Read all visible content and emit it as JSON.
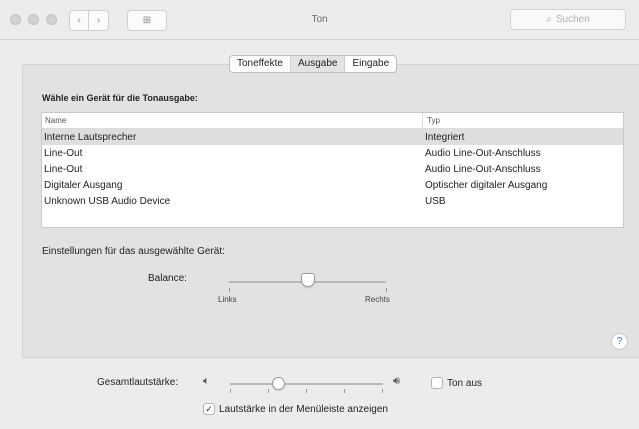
{
  "window": {
    "title": "Ton",
    "search_placeholder": "Suchen",
    "grid_icon": "⊞"
  },
  "tabs": [
    {
      "label": "Toneffekte",
      "active": false
    },
    {
      "label": "Ausgabe",
      "active": true
    },
    {
      "label": "Eingabe",
      "active": false
    }
  ],
  "output": {
    "heading": "Wähle ein Gerät für die Tonausgabe:",
    "columns": [
      "Name",
      "Typ"
    ],
    "devices": [
      {
        "name": "Interne Lautsprecher",
        "type": "Integriert",
        "selected": true
      },
      {
        "name": "Line-Out",
        "type": "Audio Line-Out-Anschluss",
        "selected": false
      },
      {
        "name": "Line-Out",
        "type": "Audio Line-Out-Anschluss",
        "selected": false
      },
      {
        "name": "Digitaler Ausgang",
        "type": "Optischer digitaler Ausgang",
        "selected": false
      },
      {
        "name": "Unknown USB Audio Device",
        "type": "USB",
        "selected": false
      }
    ]
  },
  "settings": {
    "label": "Einstellungen für das ausgewählte Gerät:",
    "balance_label": "Balance:",
    "balance_left": "Links",
    "balance_right": "Rechts",
    "balance_value": 0.5
  },
  "help_label": "?",
  "volume": {
    "label": "Gesamtlautstärke:",
    "value": 0.32,
    "mute_label": "Ton aus",
    "mute_checked": false,
    "menubar_label": "Lautstärke in der Menüleiste anzeigen",
    "menubar_checked": true
  }
}
